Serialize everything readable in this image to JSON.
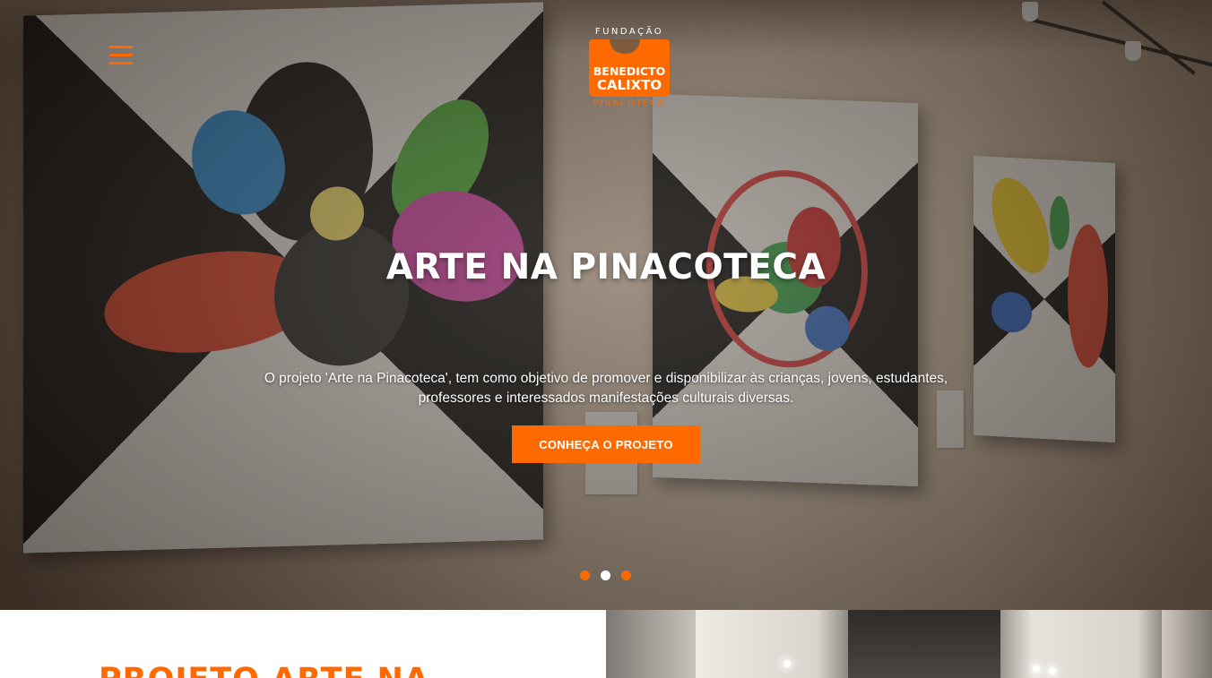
{
  "header": {
    "menu_icon": "hamburger-menu-icon",
    "logo": {
      "top_text": "FUNDAÇÃO",
      "name_line1": "BENEDICTO",
      "name_line2": "CALIXTO",
      "bottom_text": "PINACOTECA"
    }
  },
  "hero": {
    "title": "ARTE NA PINACOTECA",
    "description": "O projeto 'Arte na Pinacoteca', tem como objetivo de promover e disponibilizar às crianças, jovens, estudantes, professores e interessados manifestações culturais diversas.",
    "cta_label": "CONHEÇA O PROJETO",
    "slides": {
      "count": 3,
      "active_index": 1
    }
  },
  "section": {
    "heading": "PROJETO ARTE NA"
  },
  "colors": {
    "accent": "#ff6a00",
    "text_light": "#ffffff"
  }
}
